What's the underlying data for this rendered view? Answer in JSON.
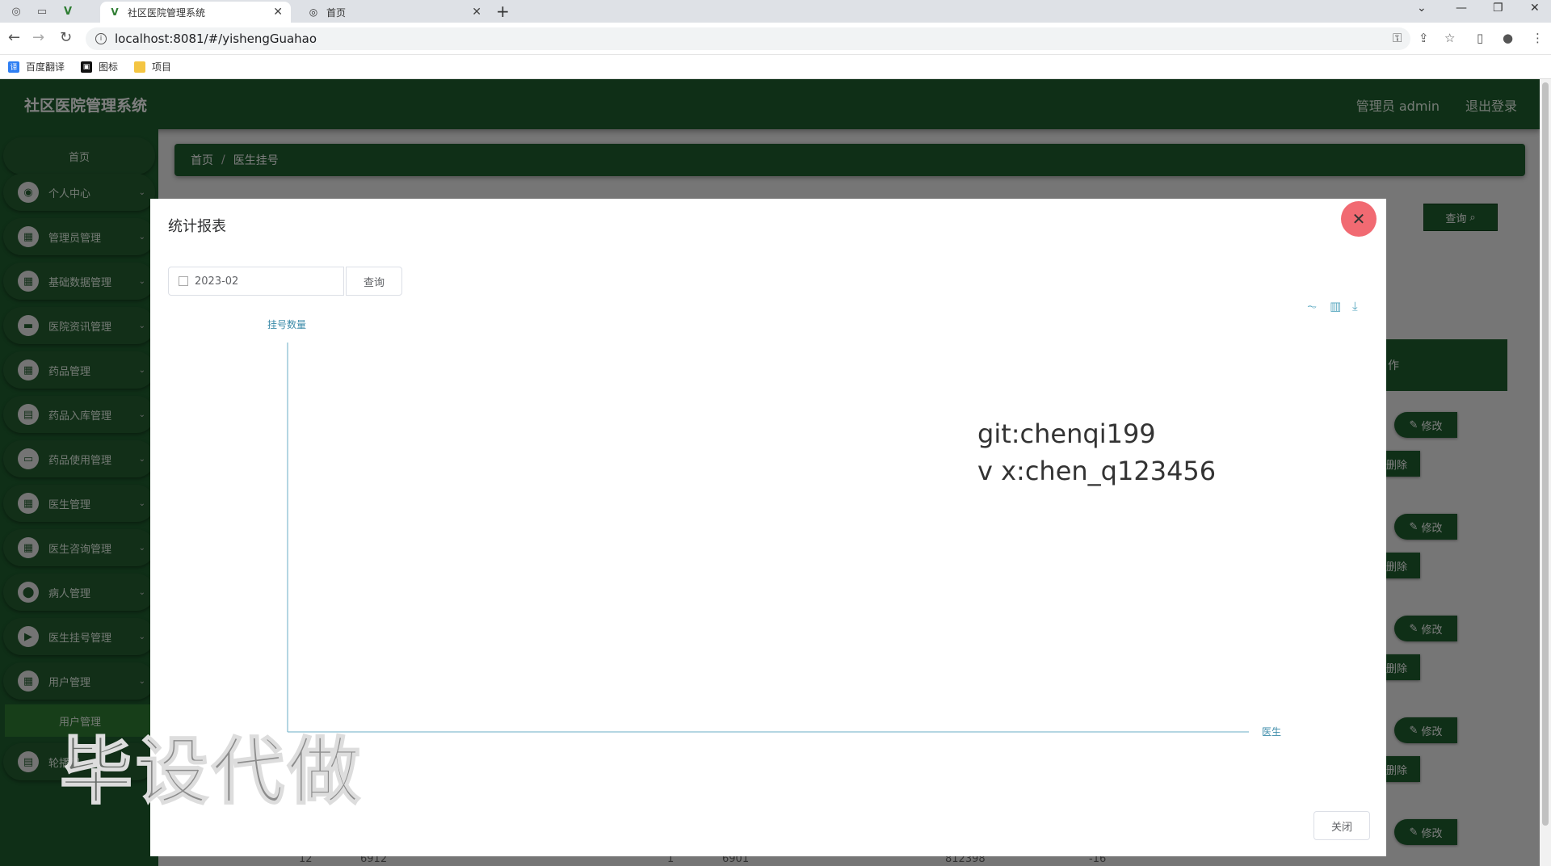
{
  "browser": {
    "tabs": [
      {
        "title": "社区医院管理系统",
        "active": true
      },
      {
        "title": "首页",
        "active": false
      }
    ],
    "url": "localhost:8081/#/yishengGuahao",
    "bookmarks": [
      "百度翻译",
      "图标",
      "项目"
    ]
  },
  "app": {
    "brand": "社区医院管理系统",
    "admin_label": "管理员 admin",
    "logout_label": "退出登录",
    "accent": "#1e5e2e",
    "sidebar": {
      "home": "首页",
      "items": [
        {
          "label": "个人中心",
          "icon": "person-icon"
        },
        {
          "label": "管理员管理",
          "icon": "grid-icon"
        },
        {
          "label": "基础数据管理",
          "icon": "grid-icon"
        },
        {
          "label": "医院资讯管理",
          "icon": "monitor-icon"
        },
        {
          "label": "药品管理",
          "icon": "grid-icon"
        },
        {
          "label": "药品入库管理",
          "icon": "clipboard-icon"
        },
        {
          "label": "药品使用管理",
          "icon": "chat-icon"
        },
        {
          "label": "医生管理",
          "icon": "grid-icon"
        },
        {
          "label": "医生咨询管理",
          "icon": "grid-icon"
        },
        {
          "label": "病人管理",
          "icon": "pin-icon"
        },
        {
          "label": "医生挂号管理",
          "icon": "video-icon"
        },
        {
          "label": "用户管理",
          "icon": "grid-icon"
        }
      ],
      "submenu": "用户管理",
      "last_item": {
        "label": "轮播图",
        "icon": "doc-icon"
      }
    },
    "breadcrumb": {
      "home": "首页",
      "current": "医生挂号"
    },
    "bg_search_button": "查询",
    "table_header_fragment": "作",
    "row_buttons": {
      "edit": "修改",
      "delete": "删除"
    },
    "bottom_numbers": [
      "12",
      "6912",
      "1",
      "6901",
      "812398",
      "-16"
    ]
  },
  "modal": {
    "title": "统计报表",
    "date_value": "2023-02",
    "query_label": "查询",
    "close_label": "关闭",
    "watermark_lines": [
      "git:chenqi199",
      "v x:chen_q123456"
    ],
    "overlay_watermark": "毕设代做"
  },
  "chart_data": {
    "type": "bar",
    "categories": [],
    "values": [],
    "title": "",
    "xlabel": "医生",
    "ylabel": "挂号数量",
    "toolbox": [
      "line-chart-icon",
      "bar-chart-icon",
      "download-icon"
    ]
  }
}
